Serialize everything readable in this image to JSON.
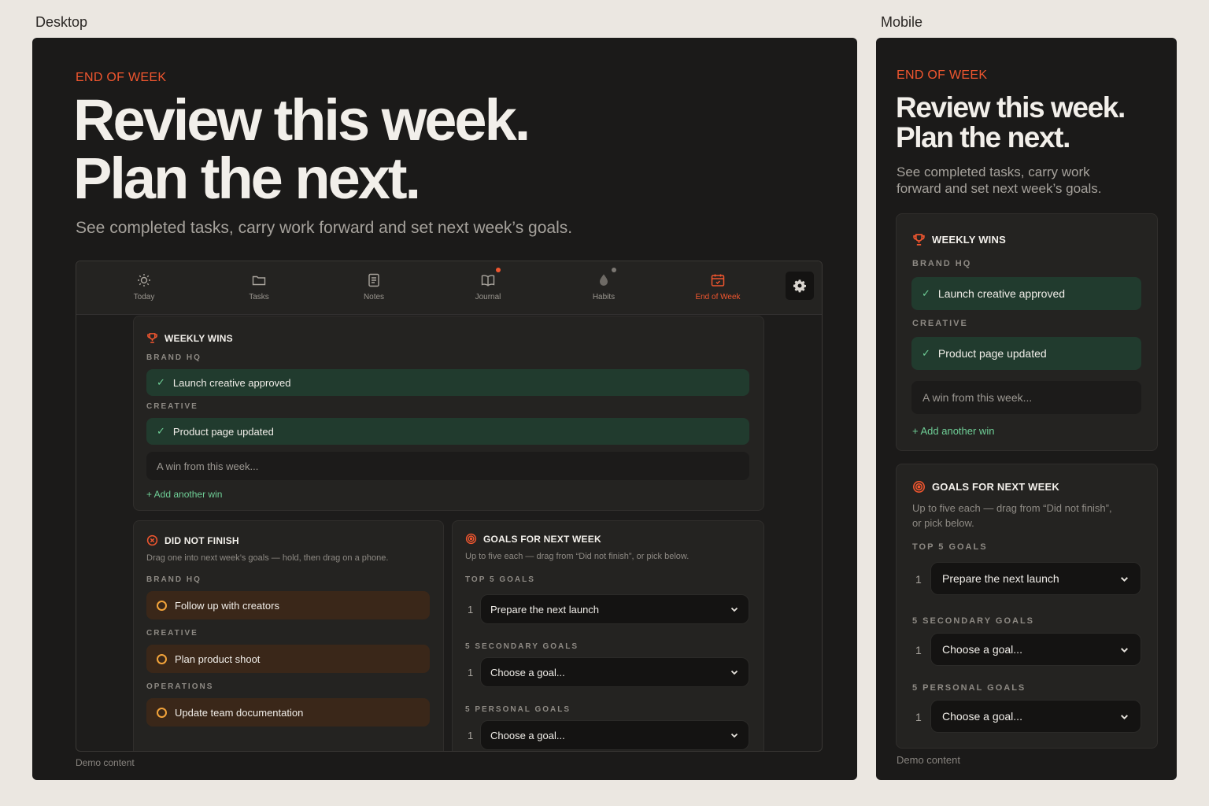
{
  "labels": {
    "desktop": "Desktop",
    "mobile": "Mobile"
  },
  "hero": {
    "eyebrow": "END OF WEEK",
    "line1": "Review this week.",
    "line2": "Plan the next.",
    "subtitle": "See completed tasks, carry work forward and set next week’s goals.",
    "mobile_sub1": "See completed tasks, carry work",
    "mobile_sub2": "forward and set next week’s goals."
  },
  "nav": [
    {
      "label": "Today",
      "icon": "sun-icon"
    },
    {
      "label": "Tasks",
      "icon": "folder-icon"
    },
    {
      "label": "Notes",
      "icon": "note-icon"
    },
    {
      "label": "Journal",
      "icon": "book-icon"
    },
    {
      "label": "Habits",
      "icon": "drop-icon"
    },
    {
      "label": "End of Week",
      "icon": "calendar-icon",
      "active": true
    }
  ],
  "wins": {
    "title": "WEEKLY WINS",
    "groups": [
      {
        "name": "BRAND HQ",
        "item": "Launch creative approved"
      },
      {
        "name": "CREATIVE",
        "item": "Product page updated"
      }
    ],
    "placeholder": "A win from this week...",
    "add": "+ Add another win"
  },
  "dnf": {
    "title": "DID NOT FINISH",
    "desc": "Drag one into next week’s goals — hold, then drag on a phone.",
    "groups": [
      {
        "name": "BRAND HQ",
        "item": "Follow up with creators"
      },
      {
        "name": "CREATIVE",
        "item": "Plan product shoot"
      },
      {
        "name": "OPERATIONS",
        "item": "Update team documentation"
      }
    ]
  },
  "goals": {
    "title": "GOALS FOR NEXT WEEK",
    "desc": "Up to five each — drag from “Did not finish”, or pick below.",
    "mobile_desc1": "Up to five each — drag from “Did not finish”,",
    "mobile_desc2": "or pick below.",
    "sections": [
      {
        "name": "TOP 5 GOALS",
        "num": "1",
        "value": "Prepare the next launch"
      },
      {
        "name": "5 SECONDARY GOALS",
        "num": "1",
        "value": "Choose a goal..."
      },
      {
        "name": "5 PERSONAL GOALS",
        "num": "1",
        "value": "Choose a goal..."
      }
    ]
  },
  "footer": "Demo content",
  "colors": {
    "accent": "#f0562f",
    "win": "#213b2e",
    "dnf": "#3a2719",
    "green": "#6fcf97",
    "amber": "#f2a33a"
  }
}
